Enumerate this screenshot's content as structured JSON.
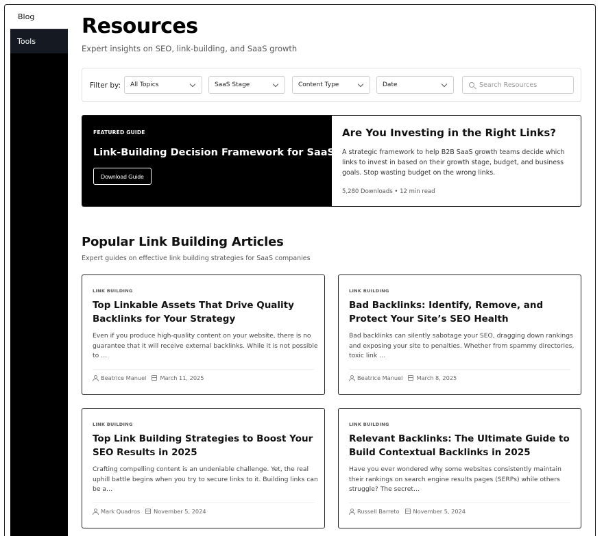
{
  "sidebar": {
    "items": [
      {
        "label": "Blog"
      },
      {
        "label": "Tools"
      }
    ]
  },
  "header": {
    "title": "Resources",
    "subtitle": "Expert insights on SEO, link-building, and SaaS growth"
  },
  "filters": {
    "label": "Filter by:",
    "topics": "All Topics",
    "stage": "SaaS Stage",
    "content_type": "Content Type",
    "date": "Date",
    "search_placeholder": "Search Resources"
  },
  "featured": {
    "tag": "FEATURED GUIDE",
    "title": "Link-Building Decision Framework for SaaS",
    "button_label": "Download Guide",
    "right_title": "Are You Investing in the Right Links?",
    "description": "A strategic framework to help B2B SaaS growth teams decide which links to invest in based on their growth stage, budget, and business goals. Stop wasting budget on the wrong links.",
    "meta": "5,280 Downloads • 12 min read"
  },
  "section": {
    "title": "Popular Link Building Articles",
    "subtitle": "Expert guides on effective link building strategies for SaaS companies"
  },
  "articles": [
    {
      "tag": "LINK BUILDING",
      "title": "Top Linkable Assets That Drive Quality Backlinks for Your Strategy",
      "excerpt": "Even if you produce high-quality content on your website, there is no guarantee that it will receive external backlinks.  While it is not possible to …",
      "author": "Beatrice Manuel",
      "date": "March 11, 2025"
    },
    {
      "tag": "LINK BUILDING",
      "title": "Bad Backlinks: Identify, Remove, and Protect Your Site’s SEO Health",
      "excerpt": "Bad backlinks can silently sabotage your SEO, dragging down rankings and exposing your site to penalties. Whether from spammy directories, toxic link …",
      "author": "Beatrice Manuel",
      "date": "March 8, 2025"
    },
    {
      "tag": "LINK BUILDING",
      "title": "Top Link Building Strategies to Boost Your SEO Results in 2025",
      "excerpt": "Crafting compelling content is an undeniable challenge. Yet, the real uphill battle begins when you try to secure links to it. Building links can be a…",
      "author": "Mark Quadros",
      "date": "November 5, 2024"
    },
    {
      "tag": "LINK BUILDING",
      "title": "Relevant Backlinks: The Ultimate Guide to Build Contextual Backlinks in 2025",
      "excerpt": "Have you ever wondered why some websites consistently maintain their rankings on search engine results pages (SERPs) while others struggle? The secret…",
      "author": "Russell Barreto",
      "date": "November 5, 2024"
    }
  ]
}
